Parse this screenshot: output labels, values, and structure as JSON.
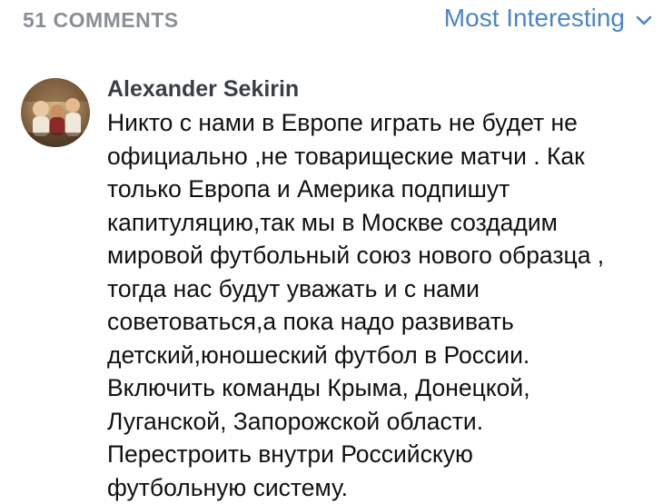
{
  "header": {
    "comments_count": "51 COMMENTS",
    "sort_label": "Most Interesting",
    "sort_icon": "chevron-down-icon"
  },
  "comment": {
    "author": "Alexander Sekirin",
    "avatar_icon": "user-avatar-photo",
    "text_lines": [
      "Никто с нами в Европе играть не будет не",
      "официально ,не товарищеские матчи . Как",
      "только Европа и Америка подпишут",
      "капитуляцию,так мы в Москве создадим",
      "мировой футбольный союз нового образца ,",
      "тогда нас будут уважать и с нами",
      "советоваться,а пока надо развивать",
      "детский,юношеский футбол в России.",
      "Включить команды Крыма, Донецкой,",
      "Луганской, Запорожской области.",
      "Перестроить внутри Российскую",
      "футбольную систему."
    ]
  },
  "colors": {
    "accent": "#4a86c8",
    "muted": "#8a8f96",
    "author": "#3a3f47",
    "text": "#111111"
  }
}
